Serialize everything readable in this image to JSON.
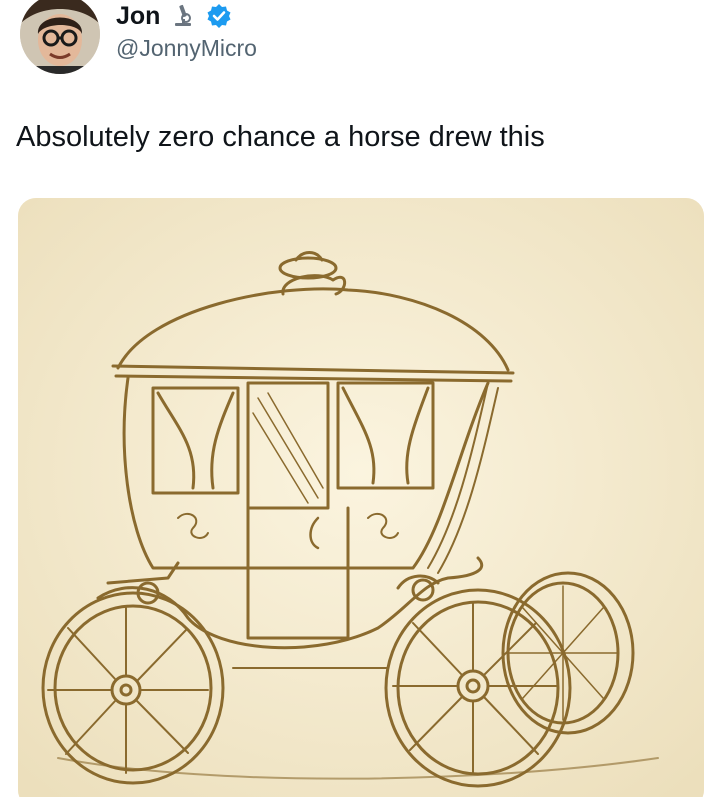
{
  "tweet": {
    "author_name": "Jon",
    "author_handle": "@JonnyMicro",
    "text": "Absolutely zero chance a horse drew this",
    "verified": true
  },
  "icons": {
    "avatar": "avatar-photo",
    "name_emoji": "microscope-icon",
    "verified_badge": "verified-badge-icon"
  },
  "colors": {
    "text_primary": "#0f1419",
    "text_secondary": "#536471",
    "verified_blue": "#1d9bf0",
    "sketch_ink": "#8a6a2e",
    "paper": "#f5ecd3"
  },
  "media": {
    "type": "image",
    "subject": "carriage-sketch"
  }
}
